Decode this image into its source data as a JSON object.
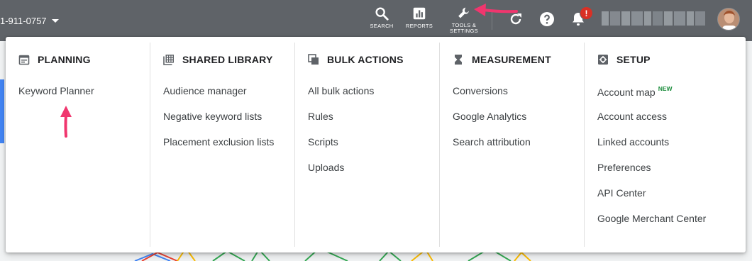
{
  "topbar": {
    "account_id": "1-911-0757",
    "buttons": [
      {
        "id": "search",
        "label": "SEARCH"
      },
      {
        "id": "reports",
        "label": "REPORTS"
      },
      {
        "id": "tools",
        "label": "TOOLS &\nSETTINGS"
      }
    ],
    "notification_badge": "!",
    "icons": [
      "search-icon",
      "reports-icon",
      "wrench-icon",
      "refresh-icon",
      "help-icon",
      "bell-icon"
    ]
  },
  "menu": {
    "columns": [
      {
        "title": "PLANNING",
        "icon": "calendar-icon",
        "items": [
          "Keyword Planner"
        ]
      },
      {
        "title": "SHARED LIBRARY",
        "icon": "library-icon",
        "items": [
          "Audience manager",
          "Negative keyword lists",
          "Placement exclusion lists"
        ]
      },
      {
        "title": "BULK ACTIONS",
        "icon": "copy-icon",
        "items": [
          "All bulk actions",
          "Rules",
          "Scripts",
          "Uploads"
        ]
      },
      {
        "title": "MEASUREMENT",
        "icon": "hourglass-icon",
        "items": [
          "Conversions",
          "Google Analytics",
          "Search attribution"
        ]
      },
      {
        "title": "SETUP",
        "icon": "settings-icon",
        "items": [
          "Account map",
          "Account access",
          "Linked accounts",
          "Preferences",
          "API Center",
          "Google Merchant Center"
        ]
      }
    ],
    "new_tag": "NEW"
  },
  "colors": {
    "topbar_bg": "#5f6368",
    "annotation_arrow": "#f0366e",
    "badge": "#d93025",
    "new_tag": "#1e8e3e"
  }
}
